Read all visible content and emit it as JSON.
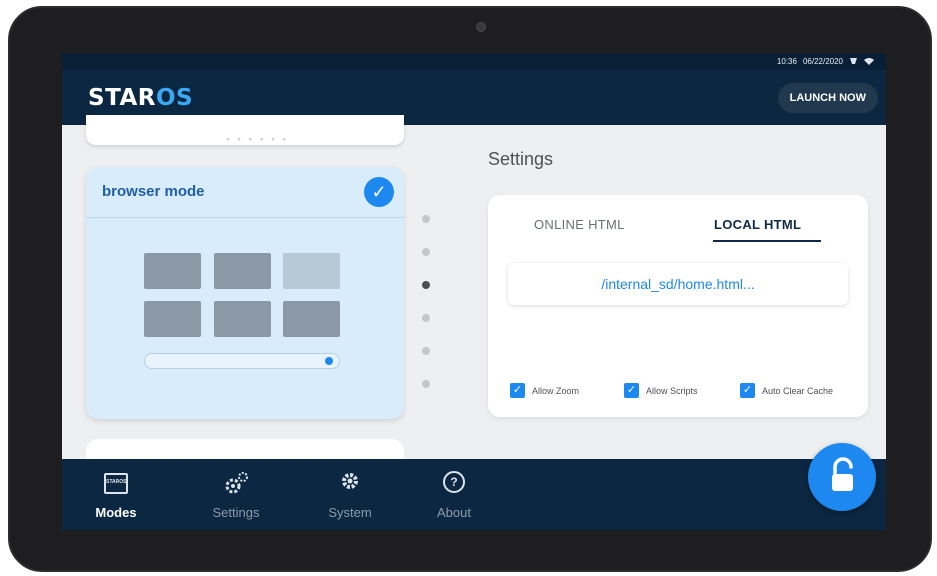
{
  "status_bar": {
    "time": "10:36",
    "date": "06/22/2020",
    "icons": [
      "battery-icon",
      "wifi-icon"
    ]
  },
  "header": {
    "logo_part1": "STAR",
    "logo_part2": "OS",
    "launch_button": "LAUNCH NOW"
  },
  "modes": {
    "selected_card": {
      "title": "browser mode",
      "selected": true
    },
    "page_count": 6,
    "active_page": 3
  },
  "settings": {
    "title": "Settings",
    "tabs": [
      {
        "label": "ONLINE HTML",
        "active": false
      },
      {
        "label": "LOCAL HTML",
        "active": true
      }
    ],
    "path_value": "/internal_sd/home.html...",
    "options": [
      {
        "label": "Allow Zoom",
        "checked": true
      },
      {
        "label": "Allow Scripts",
        "checked": true
      },
      {
        "label": "Auto Clear Cache",
        "checked": true
      }
    ]
  },
  "nav": {
    "items": [
      {
        "label": "Modes",
        "active": true,
        "icon": "modes-icon",
        "icon_text": "STAROS"
      },
      {
        "label": "Settings",
        "active": false,
        "icon": "gears-icon"
      },
      {
        "label": "System",
        "active": false,
        "icon": "gear-icon"
      },
      {
        "label": "About",
        "active": false,
        "icon": "question-icon"
      }
    ]
  },
  "lock_button": {
    "icon": "unlock-icon"
  },
  "colors": {
    "accent": "#1d89f0",
    "navy": "#0b2741",
    "card_selected": "#d9ecfb"
  }
}
